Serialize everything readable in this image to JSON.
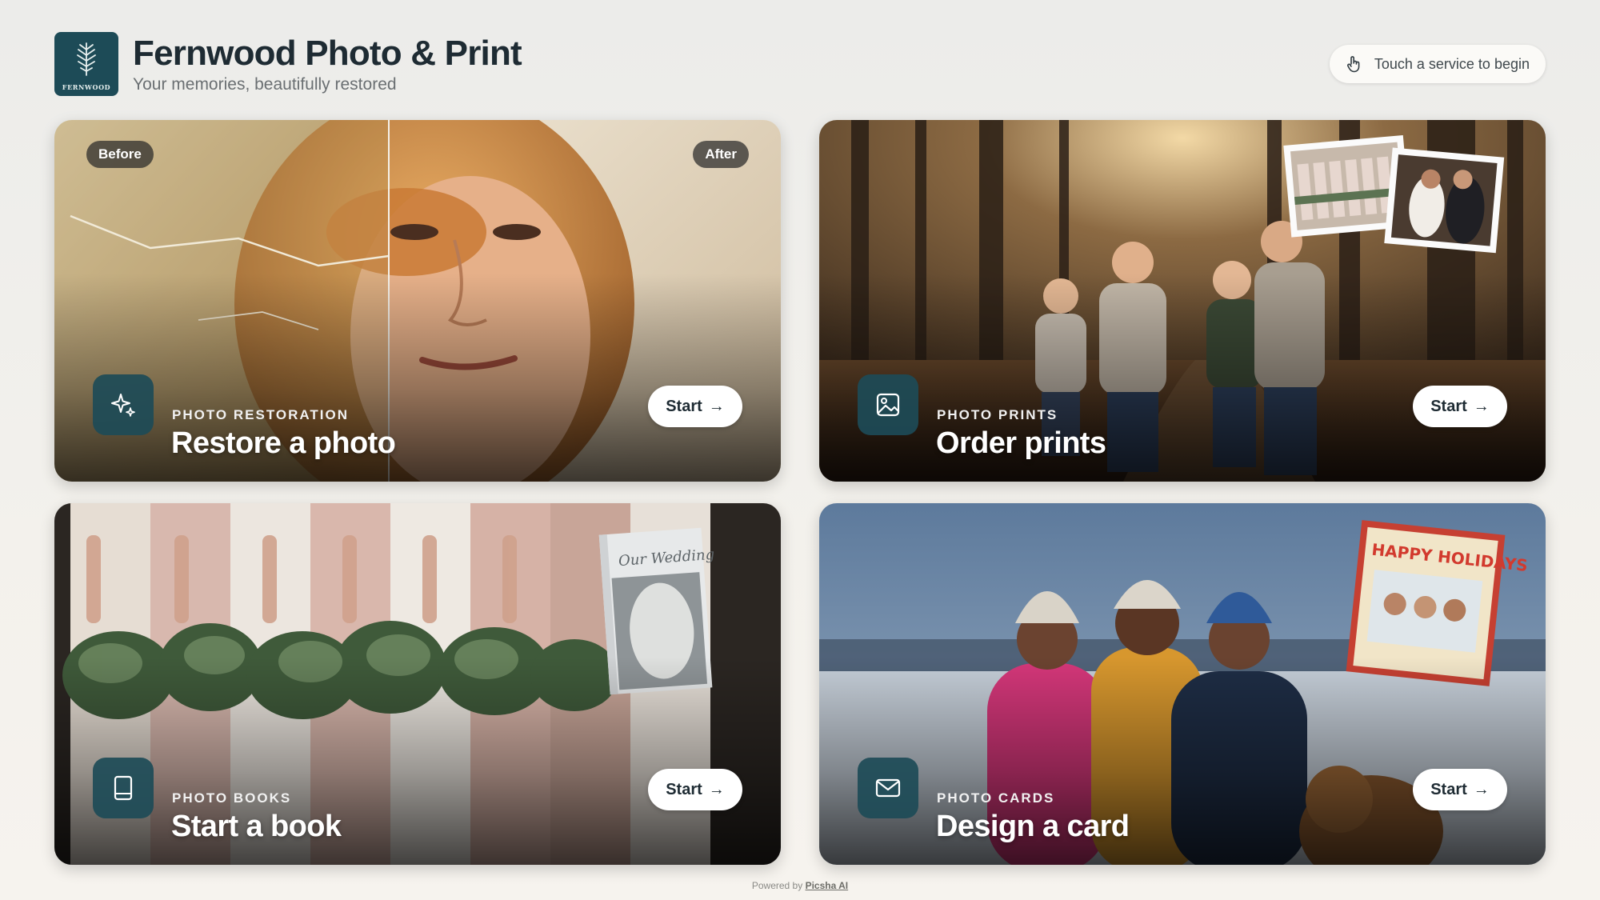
{
  "header": {
    "logo_text": "FERNWOOD",
    "title": "Fernwood Photo & Print",
    "subtitle": "Your memories, beautifully restored",
    "hint": "Touch a service to begin",
    "hint_icon": "hand-pointer-icon",
    "brand_color": "#1d4b57"
  },
  "cards": [
    {
      "eyebrow": "PHOTO RESTORATION",
      "title": "Restore a photo",
      "icon": "sparkles-icon",
      "button": "Start",
      "before_label": "Before",
      "after_label": "After"
    },
    {
      "eyebrow": "PHOTO PRINTS",
      "title": "Order prints",
      "icon": "image-icon",
      "button": "Start"
    },
    {
      "eyebrow": "PHOTO BOOKS",
      "title": "Start a book",
      "icon": "book-icon",
      "button": "Start",
      "book_cover_text": "Our Wedding"
    },
    {
      "eyebrow": "PHOTO CARDS",
      "title": "Design a card",
      "icon": "envelope-icon",
      "button": "Start",
      "card_headline": "HAPPY HOLIDAYS"
    }
  ],
  "footer": {
    "prefix": "Powered by",
    "brand": "Picsha AI"
  }
}
